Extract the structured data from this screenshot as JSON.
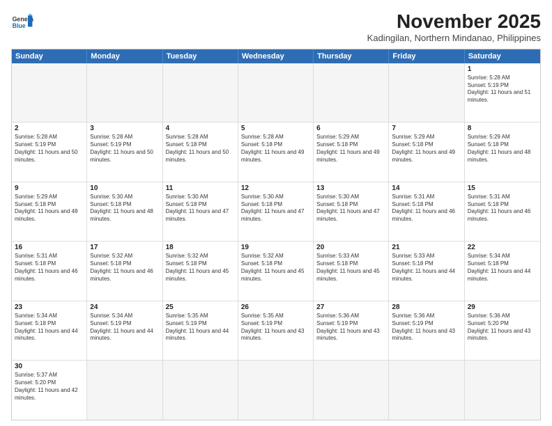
{
  "header": {
    "logo_general": "General",
    "logo_blue": "Blue",
    "month_year": "November 2025",
    "location": "Kadingilan, Northern Mindanao, Philippines"
  },
  "weekdays": [
    "Sunday",
    "Monday",
    "Tuesday",
    "Wednesday",
    "Thursday",
    "Friday",
    "Saturday"
  ],
  "rows": [
    [
      {
        "day": "",
        "empty": true
      },
      {
        "day": "",
        "empty": true
      },
      {
        "day": "",
        "empty": true
      },
      {
        "day": "",
        "empty": true
      },
      {
        "day": "",
        "empty": true
      },
      {
        "day": "",
        "empty": true
      },
      {
        "day": "1",
        "sunrise": "Sunrise: 5:28 AM",
        "sunset": "Sunset: 5:19 PM",
        "daylight": "Daylight: 11 hours and 51 minutes."
      }
    ],
    [
      {
        "day": "2",
        "sunrise": "Sunrise: 5:28 AM",
        "sunset": "Sunset: 5:19 PM",
        "daylight": "Daylight: 11 hours and 50 minutes."
      },
      {
        "day": "3",
        "sunrise": "Sunrise: 5:28 AM",
        "sunset": "Sunset: 5:19 PM",
        "daylight": "Daylight: 11 hours and 50 minutes."
      },
      {
        "day": "4",
        "sunrise": "Sunrise: 5:28 AM",
        "sunset": "Sunset: 5:18 PM",
        "daylight": "Daylight: 11 hours and 50 minutes."
      },
      {
        "day": "5",
        "sunrise": "Sunrise: 5:28 AM",
        "sunset": "Sunset: 5:18 PM",
        "daylight": "Daylight: 11 hours and 49 minutes."
      },
      {
        "day": "6",
        "sunrise": "Sunrise: 5:29 AM",
        "sunset": "Sunset: 5:18 PM",
        "daylight": "Daylight: 11 hours and 49 minutes."
      },
      {
        "day": "7",
        "sunrise": "Sunrise: 5:29 AM",
        "sunset": "Sunset: 5:18 PM",
        "daylight": "Daylight: 11 hours and 49 minutes."
      },
      {
        "day": "8",
        "sunrise": "Sunrise: 5:29 AM",
        "sunset": "Sunset: 5:18 PM",
        "daylight": "Daylight: 11 hours and 48 minutes."
      }
    ],
    [
      {
        "day": "9",
        "sunrise": "Sunrise: 5:29 AM",
        "sunset": "Sunset: 5:18 PM",
        "daylight": "Daylight: 11 hours and 48 minutes."
      },
      {
        "day": "10",
        "sunrise": "Sunrise: 5:30 AM",
        "sunset": "Sunset: 5:18 PM",
        "daylight": "Daylight: 11 hours and 48 minutes."
      },
      {
        "day": "11",
        "sunrise": "Sunrise: 5:30 AM",
        "sunset": "Sunset: 5:18 PM",
        "daylight": "Daylight: 11 hours and 47 minutes."
      },
      {
        "day": "12",
        "sunrise": "Sunrise: 5:30 AM",
        "sunset": "Sunset: 5:18 PM",
        "daylight": "Daylight: 11 hours and 47 minutes."
      },
      {
        "day": "13",
        "sunrise": "Sunrise: 5:30 AM",
        "sunset": "Sunset: 5:18 PM",
        "daylight": "Daylight: 11 hours and 47 minutes."
      },
      {
        "day": "14",
        "sunrise": "Sunrise: 5:31 AM",
        "sunset": "Sunset: 5:18 PM",
        "daylight": "Daylight: 11 hours and 46 minutes."
      },
      {
        "day": "15",
        "sunrise": "Sunrise: 5:31 AM",
        "sunset": "Sunset: 5:18 PM",
        "daylight": "Daylight: 11 hours and 46 minutes."
      }
    ],
    [
      {
        "day": "16",
        "sunrise": "Sunrise: 5:31 AM",
        "sunset": "Sunset: 5:18 PM",
        "daylight": "Daylight: 11 hours and 46 minutes."
      },
      {
        "day": "17",
        "sunrise": "Sunrise: 5:32 AM",
        "sunset": "Sunset: 5:18 PM",
        "daylight": "Daylight: 11 hours and 46 minutes."
      },
      {
        "day": "18",
        "sunrise": "Sunrise: 5:32 AM",
        "sunset": "Sunset: 5:18 PM",
        "daylight": "Daylight: 11 hours and 45 minutes."
      },
      {
        "day": "19",
        "sunrise": "Sunrise: 5:32 AM",
        "sunset": "Sunset: 5:18 PM",
        "daylight": "Daylight: 11 hours and 45 minutes."
      },
      {
        "day": "20",
        "sunrise": "Sunrise: 5:33 AM",
        "sunset": "Sunset: 5:18 PM",
        "daylight": "Daylight: 11 hours and 45 minutes."
      },
      {
        "day": "21",
        "sunrise": "Sunrise: 5:33 AM",
        "sunset": "Sunset: 5:18 PM",
        "daylight": "Daylight: 11 hours and 44 minutes."
      },
      {
        "day": "22",
        "sunrise": "Sunrise: 5:34 AM",
        "sunset": "Sunset: 5:18 PM",
        "daylight": "Daylight: 11 hours and 44 minutes."
      }
    ],
    [
      {
        "day": "23",
        "sunrise": "Sunrise: 5:34 AM",
        "sunset": "Sunset: 5:18 PM",
        "daylight": "Daylight: 11 hours and 44 minutes."
      },
      {
        "day": "24",
        "sunrise": "Sunrise: 5:34 AM",
        "sunset": "Sunset: 5:19 PM",
        "daylight": "Daylight: 11 hours and 44 minutes."
      },
      {
        "day": "25",
        "sunrise": "Sunrise: 5:35 AM",
        "sunset": "Sunset: 5:19 PM",
        "daylight": "Daylight: 11 hours and 44 minutes."
      },
      {
        "day": "26",
        "sunrise": "Sunrise: 5:35 AM",
        "sunset": "Sunset: 5:19 PM",
        "daylight": "Daylight: 11 hours and 43 minutes."
      },
      {
        "day": "27",
        "sunrise": "Sunrise: 5:36 AM",
        "sunset": "Sunset: 5:19 PM",
        "daylight": "Daylight: 11 hours and 43 minutes."
      },
      {
        "day": "28",
        "sunrise": "Sunrise: 5:36 AM",
        "sunset": "Sunset: 5:19 PM",
        "daylight": "Daylight: 11 hours and 43 minutes."
      },
      {
        "day": "29",
        "sunrise": "Sunrise: 5:36 AM",
        "sunset": "Sunset: 5:20 PM",
        "daylight": "Daylight: 11 hours and 43 minutes."
      }
    ],
    [
      {
        "day": "30",
        "sunrise": "Sunrise: 5:37 AM",
        "sunset": "Sunset: 5:20 PM",
        "daylight": "Daylight: 11 hours and 42 minutes."
      },
      {
        "day": "",
        "empty": true
      },
      {
        "day": "",
        "empty": true
      },
      {
        "day": "",
        "empty": true
      },
      {
        "day": "",
        "empty": true
      },
      {
        "day": "",
        "empty": true
      },
      {
        "day": "",
        "empty": true
      }
    ]
  ]
}
